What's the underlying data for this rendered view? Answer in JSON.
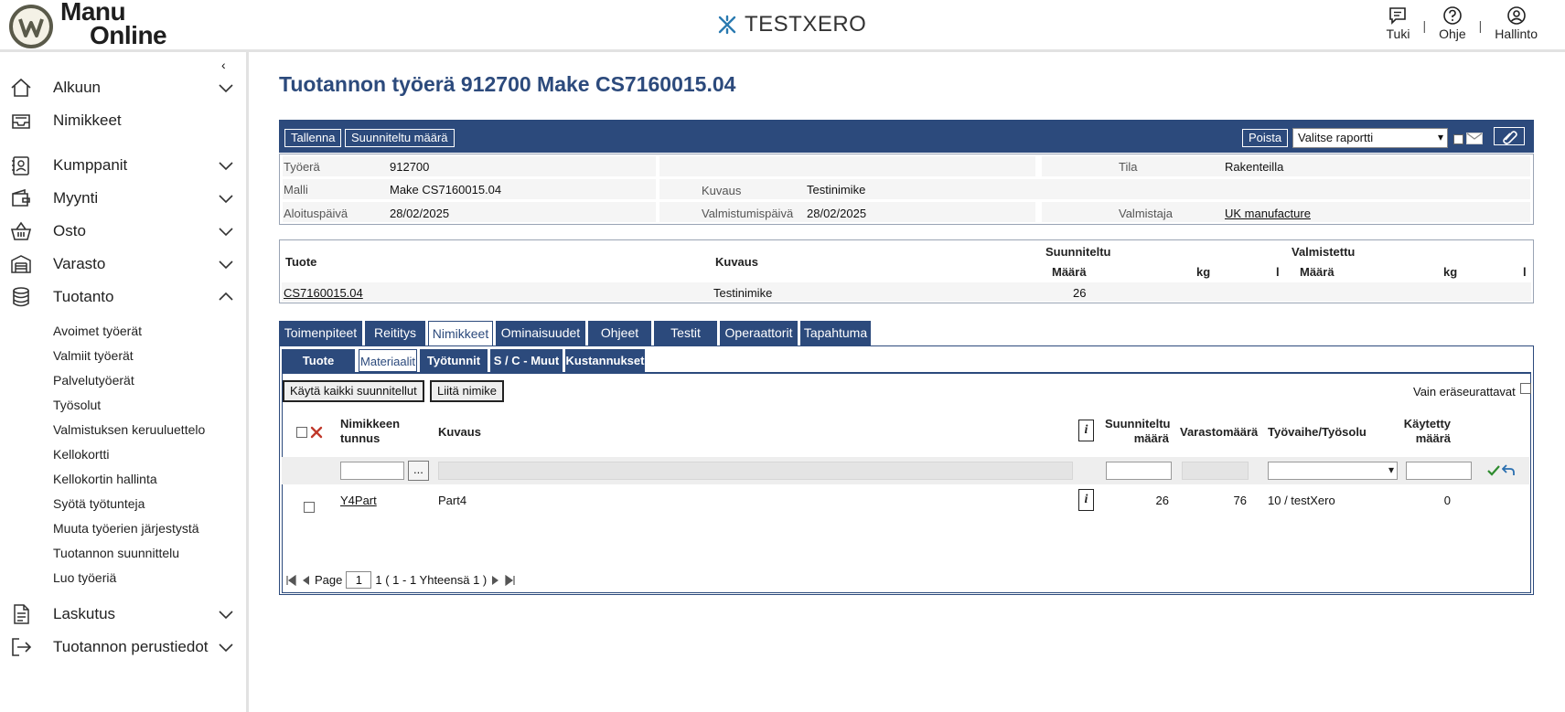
{
  "header": {
    "logo_line1": "Manu",
    "logo_line2": "Online",
    "brand": "TESTXERO",
    "links": [
      {
        "label": "Tuki",
        "icon": "chat-icon"
      },
      {
        "label": "Ohje",
        "icon": "help-icon"
      },
      {
        "label": "Hallinto",
        "icon": "user-icon"
      }
    ],
    "separator": "|"
  },
  "sidebar": {
    "collapse_icon": "‹",
    "items": [
      {
        "label": "Alkuun",
        "icon": "home-icon",
        "expandable": true
      },
      {
        "label": "Nimikkeet",
        "icon": "inbox-icon",
        "expandable": false
      },
      {
        "label": "Kumppanit",
        "icon": "contacts-icon",
        "expandable": true
      },
      {
        "label": "Myynti",
        "icon": "wallet-icon",
        "expandable": true
      },
      {
        "label": "Osto",
        "icon": "basket-icon",
        "expandable": true
      },
      {
        "label": "Varasto",
        "icon": "warehouse-icon",
        "expandable": true
      },
      {
        "label": "Tuotanto",
        "icon": "database-icon",
        "expandable": true,
        "expanded": true
      },
      {
        "label": "Laskutus",
        "icon": "document-icon",
        "expandable": true
      },
      {
        "label": "Tuotannon perustiedot",
        "icon": "logout-icon",
        "expandable": true
      }
    ],
    "tuotanto_sub": [
      "Avoimet työerät",
      "Valmiit työerät",
      "Palvelutyöerät",
      "Työsolut",
      "Valmistuksen keruuluettelo",
      "Kellokortti",
      "Kellokortin hallinta",
      "Syötä työtunteja",
      "Muuta työerien järjestystä",
      "Tuotannon suunnittelu",
      "Luo työeriä"
    ]
  },
  "main": {
    "title": "Tuotannon työerä 912700 Make CS7160015.04",
    "toolbar": {
      "save": "Tallenna",
      "planned_qty": "Suunniteltu määrä",
      "delete": "Poista",
      "report_select": "Valitse raportti"
    },
    "info": {
      "tyoera_label": "Työerä",
      "tyoera_value": "912700",
      "tila_label": "Tila",
      "tila_value": "Rakenteilla",
      "malli_label": "Malli",
      "malli_value": "Make CS7160015.04",
      "kuvaus_label": "Kuvaus",
      "kuvaus_value": "Testinimike",
      "aloitus_label": "Aloituspäivä",
      "aloitus_value": "28/02/2025",
      "valmistumis_label": "Valmistumispäivä",
      "valmistumis_value": "28/02/2025",
      "valmistaja_label": "Valmistaja",
      "valmistaja_value": "UK manufacture"
    },
    "product": {
      "h_tuote": "Tuote",
      "h_kuvaus": "Kuvaus",
      "h_suunniteltu": "Suunniteltu",
      "h_valmistettu": "Valmistettu",
      "h_maara": "Määrä",
      "h_kg": "kg",
      "h_l": "l",
      "row": {
        "tuote": "CS7160015.04",
        "kuvaus": "Testinimike",
        "suunniteltu_maara": "26"
      }
    },
    "tabs": [
      "Toimenpiteet",
      "Reititys",
      "Nimikkeet",
      "Ominaisuudet",
      "Ohjeet",
      "Testit",
      "Operaattorit",
      "Tapahtuma"
    ],
    "active_tab": "Nimikkeet",
    "subtabs": [
      "Tuote",
      "Materiaalit",
      "Työtunnit",
      "S / C - Muut",
      "Kustannukset"
    ],
    "active_subtab": "Materiaalit",
    "grid": {
      "use_all_btn": "Käytä kaikki suunnitellut",
      "attach_btn": "Liitä nimike",
      "batch_only_label": "Vain eräseurattavat",
      "headers": {
        "code": "Nimikkeen tunnus",
        "desc": "Kuvaus",
        "info": "i",
        "planned": "Suunniteltu määrä",
        "stock": "Varastomäärä",
        "operation": "Työvaihe/Työsolu",
        "used": "Käytetty määrä"
      },
      "lookup_btn": "...",
      "rows": [
        {
          "code": "Y4Part",
          "desc": "Part4",
          "planned": "26",
          "stock": "76",
          "operation": "10 / testXero",
          "used": "0"
        }
      ],
      "pager": {
        "page_label": "Page",
        "page": "1",
        "summary": "1 ( 1 - 1 Yhteensä 1 )"
      }
    }
  }
}
